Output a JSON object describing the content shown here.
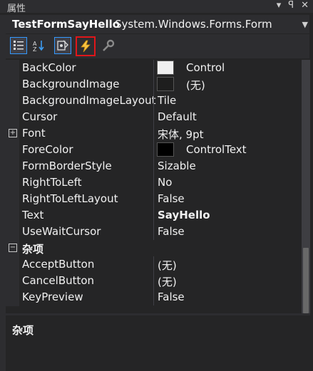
{
  "window": {
    "title": "属性",
    "pin": "▾  ⊥  ✕"
  },
  "object_selector": {
    "name": "TestFormSayHello",
    "type": "System.Windows.Forms.Form"
  },
  "toolbar": {
    "buttons": [
      {
        "name": "categorized-icon",
        "glyph": "☷",
        "selected": true
      },
      {
        "name": "alphabetical-icon",
        "glyph": "A↓",
        "selected": false
      },
      {
        "name": "properties-icon",
        "glyph": "▣",
        "selected": true
      },
      {
        "name": "events-icon",
        "glyph": "⚡",
        "selected": false,
        "highlighted": true
      },
      {
        "name": "property-pages-icon",
        "glyph": "🔧",
        "selected": false
      }
    ]
  },
  "rows": [
    {
      "name": "BackColor",
      "value": "Control",
      "swatch": "#f0f0f0"
    },
    {
      "name": "BackgroundImage",
      "value": "(无)",
      "swatch": "#1e1e1e"
    },
    {
      "name": "BackgroundImageLayout",
      "value": "Tile"
    },
    {
      "name": "Cursor",
      "value": "Default"
    },
    {
      "name": "Font",
      "value": "宋体, 9pt"
    },
    {
      "name": "ForeColor",
      "value": "ControlText",
      "swatch": "#000000"
    },
    {
      "name": "FormBorderStyle",
      "value": "Sizable"
    },
    {
      "name": "RightToLeft",
      "value": "No"
    },
    {
      "name": "RightToLeftLayout",
      "value": "False"
    },
    {
      "name": "Text",
      "value": "SayHello"
    },
    {
      "name": "UseWaitCursor",
      "value": "False"
    },
    {
      "name": "AcceptButton",
      "value": "(无)"
    },
    {
      "name": "CancelButton",
      "value": "(无)"
    },
    {
      "name": "KeyPreview",
      "value": "False"
    }
  ],
  "category": {
    "label": "杂项",
    "expander": "−"
  },
  "font_expander": "+",
  "description": {
    "title": "杂项"
  }
}
